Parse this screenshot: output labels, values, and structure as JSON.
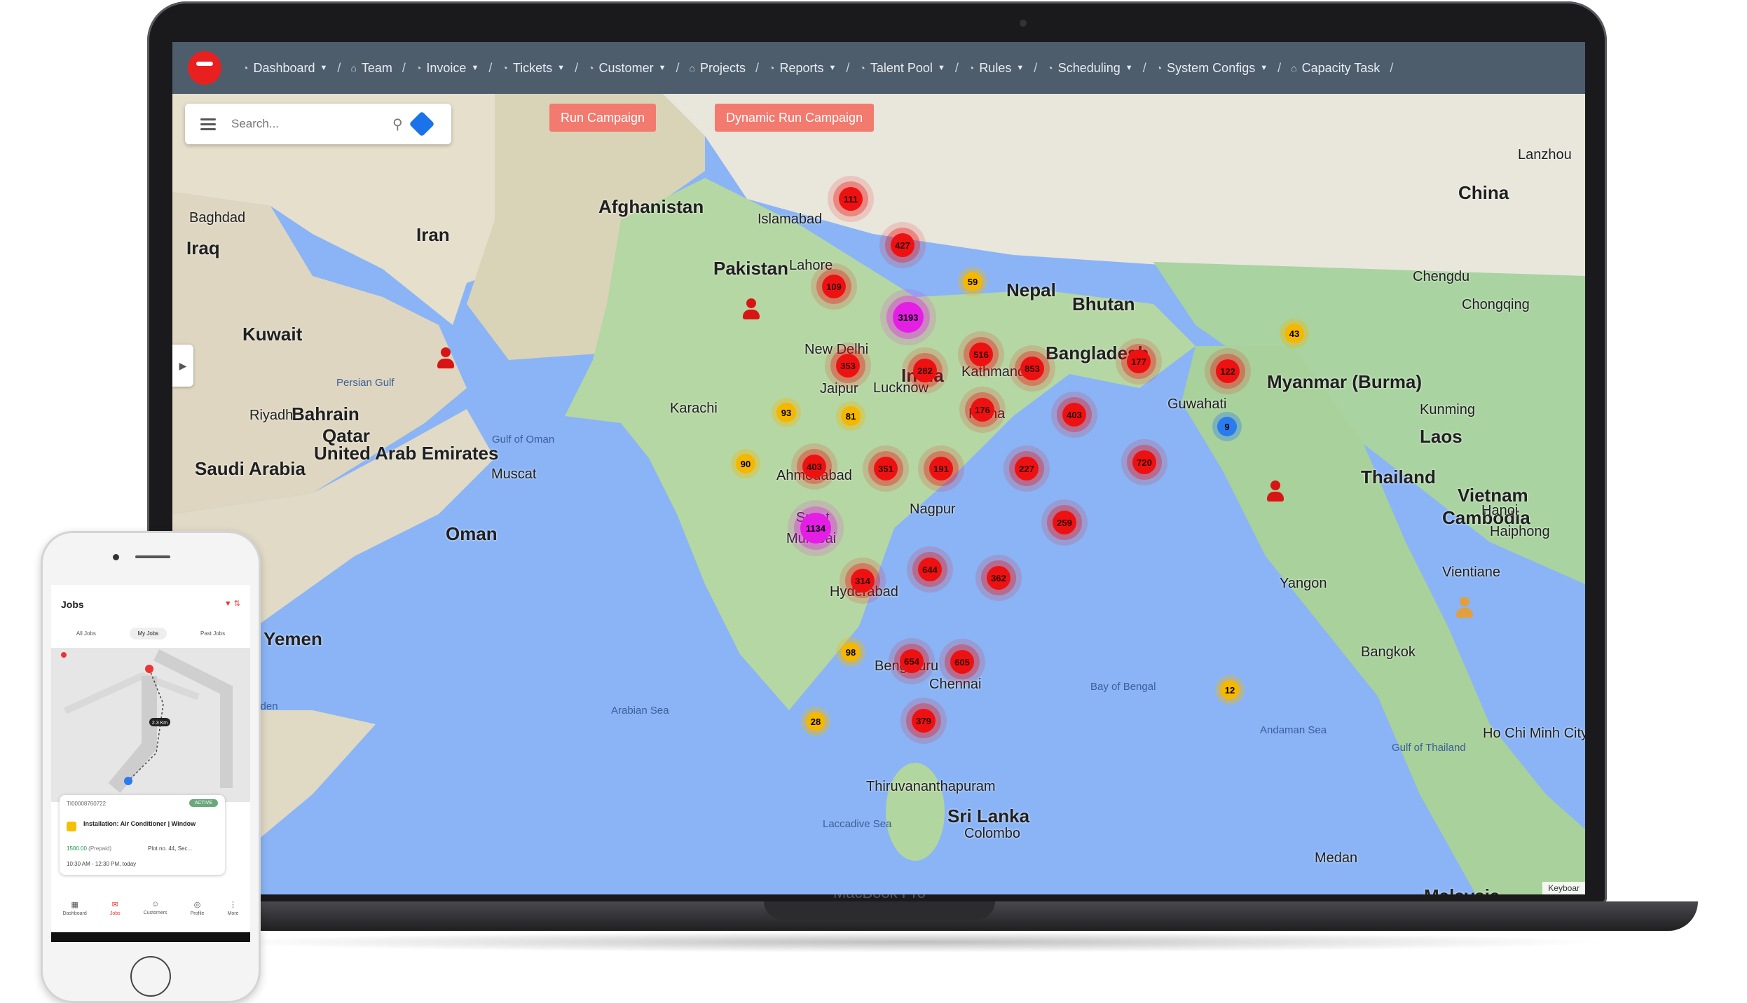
{
  "navbar": {
    "items": [
      {
        "icon": "dashboard-icon",
        "label": "Dashboard",
        "dropdown": true
      },
      {
        "icon": "home-icon",
        "label": "Team",
        "dropdown": false
      },
      {
        "icon": "dashboard-icon",
        "label": "Invoice",
        "dropdown": true
      },
      {
        "icon": "dashboard-icon",
        "label": "Tickets",
        "dropdown": true
      },
      {
        "icon": "dashboard-icon",
        "label": "Customer",
        "dropdown": true
      },
      {
        "icon": "home-icon",
        "label": "Projects",
        "dropdown": false
      },
      {
        "icon": "dashboard-icon",
        "label": "Reports",
        "dropdown": true
      },
      {
        "icon": "dashboard-icon",
        "label": "Talent Pool",
        "dropdown": true
      },
      {
        "icon": "dashboard-icon",
        "label": "Rules",
        "dropdown": true
      },
      {
        "icon": "dashboard-icon",
        "label": "Scheduling",
        "dropdown": true
      },
      {
        "icon": "dashboard-icon",
        "label": "System Configs",
        "dropdown": true
      },
      {
        "icon": "home-icon",
        "label": "Capacity Task",
        "dropdown": false
      }
    ],
    "separator": "/"
  },
  "search": {
    "placeholder": "Search..."
  },
  "buttons": {
    "run_campaign": "Run Campaign",
    "dynamic_run_campaign": "Dynamic Run Campaign"
  },
  "map_labels": {
    "countries": [
      "Afghanistan",
      "Pakistan",
      "Iran",
      "India",
      "China",
      "Nepal",
      "Bhutan",
      "Bangladesh",
      "Myanmar (Burma)",
      "Thailand",
      "Laos",
      "Vietnam",
      "Cambodia",
      "Sri Lanka",
      "Malaysia",
      "Saudi Arabia",
      "Oman",
      "Yemen",
      "Qatar",
      "United Arab Emirates",
      "Kuwait",
      "Bahrain",
      "Iraq"
    ],
    "cities": [
      "Baghdad",
      "Islamabad",
      "Lahore",
      "New Delhi",
      "Jaipur",
      "Lucknow",
      "Kathmandu",
      "Patna",
      "Ahmedabad",
      "Surat",
      "Nagpur",
      "Bengaluru",
      "Chennai",
      "Colombo",
      "Karachi",
      "Riyadh",
      "Muscat",
      "Kunming",
      "Chengdu",
      "Chongqing",
      "Hanoi",
      "Haiphong",
      "Vientiane",
      "Bangkok",
      "Ho Chi Minh City",
      "Medan",
      "Yangon",
      "Guwahati",
      "Lanzhou",
      "Thiruvananthapuram",
      "Mumbai",
      "Hyderabad"
    ],
    "seas": [
      "Arabian Sea",
      "Bay of Bengal",
      "Andaman Sea",
      "Laccadive Sea",
      "Gulf of Aden",
      "Gulf of Oman",
      "Persian Gulf",
      "Gulf of Thailand"
    ]
  },
  "clusters": [
    {
      "count": "111",
      "color": "red"
    },
    {
      "count": "427",
      "color": "red"
    },
    {
      "count": "109",
      "color": "red"
    },
    {
      "count": "59",
      "color": "yellow"
    },
    {
      "count": "3193",
      "color": "magenta"
    },
    {
      "count": "516",
      "color": "red"
    },
    {
      "count": "353",
      "color": "red"
    },
    {
      "count": "282",
      "color": "red"
    },
    {
      "count": "853",
      "color": "red"
    },
    {
      "count": "177",
      "color": "red"
    },
    {
      "count": "122",
      "color": "red"
    },
    {
      "count": "43",
      "color": "yellow"
    },
    {
      "count": "93",
      "color": "yellow"
    },
    {
      "count": "81",
      "color": "yellow"
    },
    {
      "count": "176",
      "color": "red"
    },
    {
      "count": "403",
      "color": "red"
    },
    {
      "count": "9",
      "color": "blue"
    },
    {
      "count": "90",
      "color": "yellow"
    },
    {
      "count": "403",
      "color": "red"
    },
    {
      "count": "351",
      "color": "red"
    },
    {
      "count": "191",
      "color": "red"
    },
    {
      "count": "227",
      "color": "red"
    },
    {
      "count": "720",
      "color": "red"
    },
    {
      "count": "1134",
      "color": "magenta"
    },
    {
      "count": "259",
      "color": "red"
    },
    {
      "count": "644",
      "color": "red"
    },
    {
      "count": "314",
      "color": "red"
    },
    {
      "count": "362",
      "color": "red"
    },
    {
      "count": "98",
      "color": "yellow"
    },
    {
      "count": "654",
      "color": "red"
    },
    {
      "count": "605",
      "color": "red"
    },
    {
      "count": "12",
      "color": "yellow"
    },
    {
      "count": "28",
      "color": "yellow"
    },
    {
      "count": "379",
      "color": "red"
    }
  ],
  "map_footer": "Keyboar",
  "laptop_label": "MacBook Pro",
  "phone": {
    "title": "Jobs",
    "tabs": [
      "All Jobs",
      "My Jobs",
      "Past Jobs"
    ],
    "active_tab": "My Jobs",
    "distance": "2.3 Km",
    "job": {
      "id": "TI00008760722",
      "status": "ACTIVE",
      "title": "Installation: Air Conditioner | Window",
      "price": "1500.00",
      "payment": "(Prepaid)",
      "address": "Plot no. 44, Sec...",
      "time": "10:30 AM - 12:30 PM, today"
    },
    "bottom_nav": [
      "Dashboard",
      "Jobs",
      "Customers",
      "Profile",
      "More"
    ],
    "bottom_active": "Jobs"
  },
  "colors": {
    "navbar": "#4e5d6c",
    "button": "#f27a6f",
    "accent_red": "#ee1111",
    "yellow": "#f5b700",
    "magenta": "#e51ee5",
    "blue": "#2a7bf0"
  }
}
